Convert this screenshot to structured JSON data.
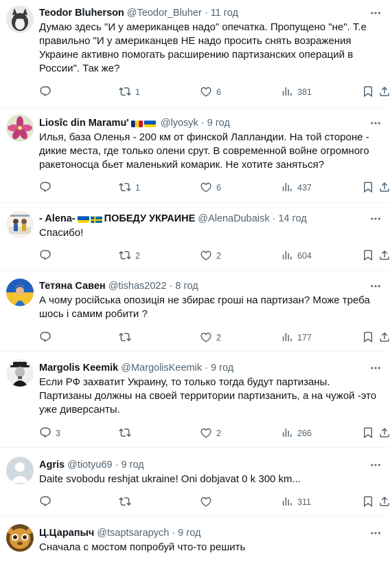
{
  "tweets": [
    {
      "name": "Teodor Bluherson",
      "handle": "@Teodor_Bluher",
      "time": "11 год",
      "text": "Думаю здесь \"И у американцев надо\" опечатка. Пропущено \"не\". Т.е правильно \"И у американцев НЕ надо просить снять возражения Украине активно помогать расширению партизанских операций в России\". Так же?",
      "replies": "",
      "retweets": "1",
      "likes": "6",
      "views": "381"
    },
    {
      "name": "Liosîc din Maramu'",
      "handle": "@lyosyk",
      "time": "9 год",
      "flags": [
        "romania",
        "ukraine"
      ],
      "text": "Илья, база Оленья - 200 км от финской Лапландии. На той стороне - дикие места, где только олени срут. В современной войне огромного ракетоносца бьет маленький комарик. Не хотите заняться?",
      "replies": "",
      "retweets": "1",
      "likes": "6",
      "views": "437"
    },
    {
      "name": "- Alena-",
      "name_suffix": "ПОБЕДУ УКРАИНЕ",
      "handle": "@AlenaDubaisk",
      "time": "14 год",
      "flags": [
        "ukraine",
        "sweden"
      ],
      "text": "Спасибо!",
      "replies": "",
      "retweets": "2",
      "likes": "2",
      "views": "604"
    },
    {
      "name": "Тетяна Савен",
      "handle": "@tishas2022",
      "time": "8 год",
      "text": "А чому російська опозиція не збирає гроші на партизан? Може треба шось і самим робити ?",
      "replies": "",
      "retweets": "",
      "likes": "2",
      "views": "177"
    },
    {
      "name": "Margolis Keemik",
      "handle": "@MargolisKeemik",
      "time": "9 год",
      "text": "Если РФ захватит Украину, то только тогда будут партизаны. Партизаны должны на своей территории партизанить, а на чужой -это уже диверсанты.",
      "replies": "3",
      "retweets": "",
      "likes": "2",
      "views": "266"
    },
    {
      "name": "Agris",
      "handle": "@tiotyu69",
      "time": "9 год",
      "text": "Daite svobodu reshjat ukraine! Oni dobjavat 0 k 300 km...",
      "replies": "",
      "retweets": "",
      "likes": "",
      "views": "311"
    },
    {
      "name": "Ц.Царапыч",
      "handle": "@tsaptsarapych",
      "time": "9 год",
      "text": "Сначала с мостом попробуй что-то решить",
      "replies": "",
      "retweets": "",
      "likes": "",
      "views": ""
    }
  ],
  "icons": {
    "reply": "reply-icon",
    "retweet": "retweet-icon",
    "like": "like-icon",
    "views": "views-icon",
    "bookmark": "bookmark-icon",
    "share": "share-icon",
    "more": "more-icon"
  },
  "colors": {
    "text": "#0f1419",
    "secondary": "#536471",
    "divider": "#eff3f4"
  }
}
